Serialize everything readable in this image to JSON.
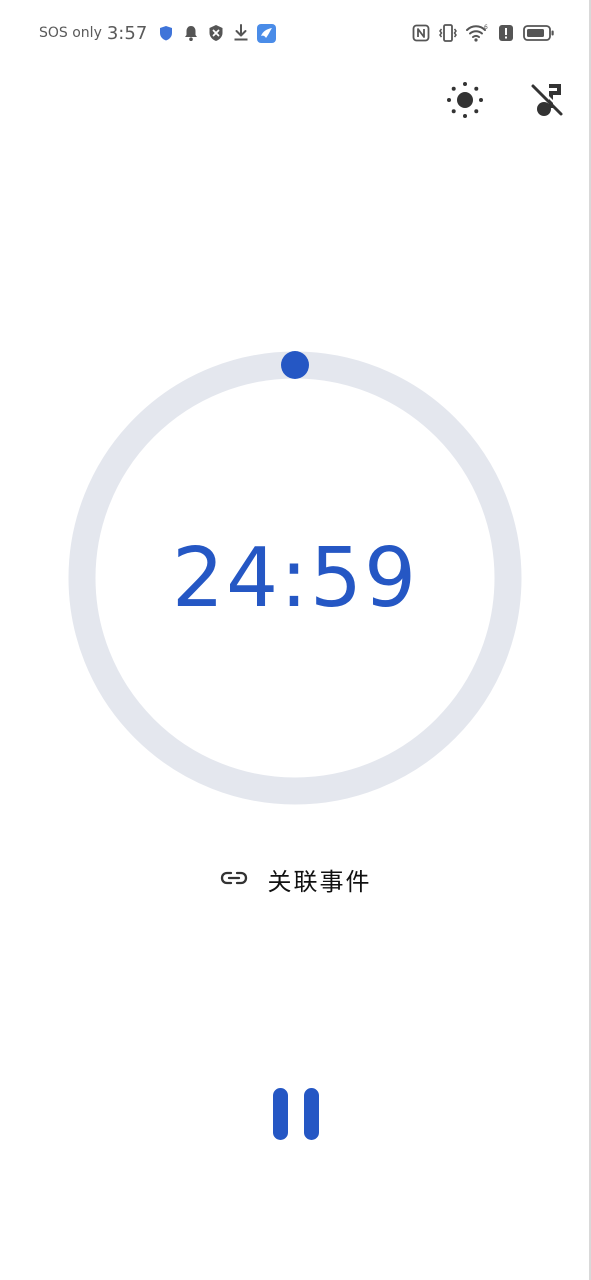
{
  "status_bar": {
    "sos_text": "SOS only",
    "time": "3:57",
    "left_icons": [
      "shield-icon",
      "bell-icon",
      "blocked-icon",
      "download-icon",
      "app-icon"
    ],
    "right_icons": [
      "nfc-icon",
      "vibrate-icon",
      "wifi-icon",
      "alert-icon",
      "battery-icon"
    ]
  },
  "toolbar": {
    "brightness_icon": "sun-icon",
    "mute_music_icon": "music-off-icon"
  },
  "timer": {
    "time": "24:59",
    "progress_fraction": 0.999,
    "ring_color": "#e4e7ee",
    "accent_color": "#2557c4"
  },
  "link_event": {
    "label": "关联事件",
    "icon": "link-icon"
  },
  "controls": {
    "pause_icon": "pause-icon"
  }
}
